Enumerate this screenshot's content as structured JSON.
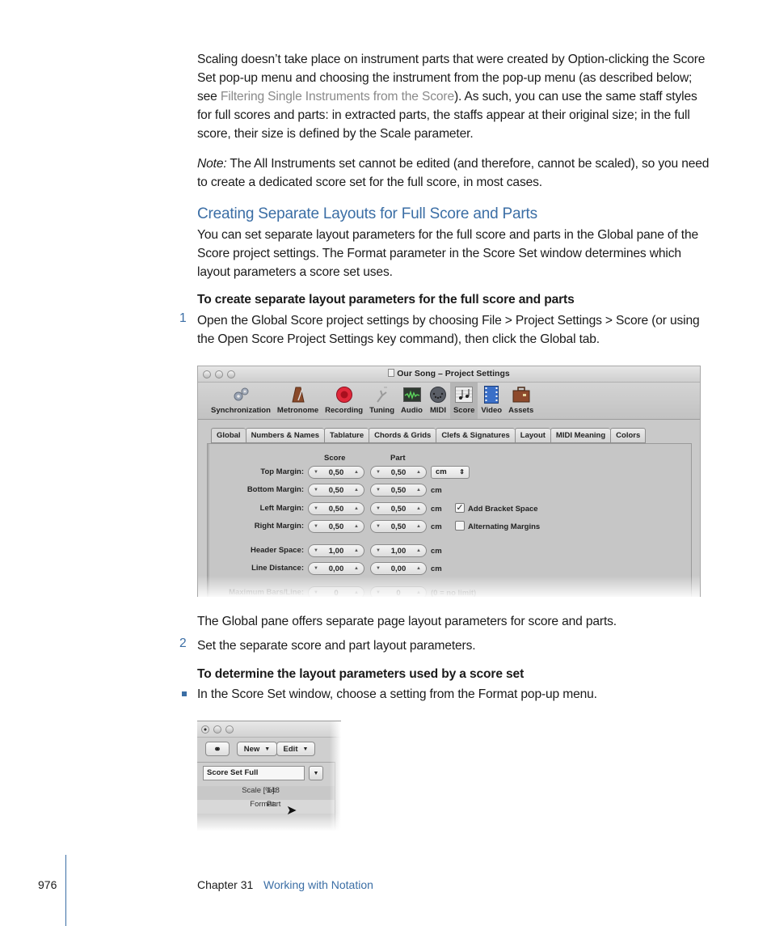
{
  "body": {
    "para1_a": "Scaling doesn’t take place on instrument parts that were created by Option-clicking the Score Set pop-up menu and choosing the instrument from the pop-up menu (as described below; see ",
    "para1_link": "Filtering Single Instruments from the Score",
    "para1_b": "). As such, you can use the same staff styles for full scores and parts:  in extracted parts, the staffs appear at their original size; in the full score, their size is defined by the Scale parameter.",
    "note_label": "Note:",
    "note_text": "  The All Instruments set cannot be edited (and therefore, cannot be scaled), so you need to create a dedicated score set for the full score, in most cases.",
    "heading": "Creating Separate Layouts for Full Score and Parts",
    "para2": "You can set separate layout parameters for the full score and parts in the Global pane of the Score project settings. The Format parameter in the Score Set window determines which layout parameters a score set uses.",
    "task1_heading": "To create separate layout parameters for the full score and parts",
    "step1_num": "1",
    "step1_text": "Open the Global Score project settings by choosing File > Project Settings > Score (or using the Open Score Project Settings key command), then click the Global tab.",
    "caption1": "The Global pane offers separate page layout parameters for score and parts.",
    "step2_num": "2",
    "step2_text": "Set the separate score and part layout parameters.",
    "task2_heading": "To determine the layout parameters used by a score set",
    "bullet1_text": "In the Score Set window, choose a setting from the Format pop-up menu."
  },
  "project_settings_window": {
    "title": "Our Song – Project Settings",
    "toolbar": [
      {
        "label": "Synchronization",
        "icon": "gears-icon"
      },
      {
        "label": "Metronome",
        "icon": "metronome-icon"
      },
      {
        "label": "Recording",
        "icon": "record-icon"
      },
      {
        "label": "Tuning",
        "icon": "tuning-fork-icon"
      },
      {
        "label": "Audio",
        "icon": "audio-waveform-icon"
      },
      {
        "label": "MIDI",
        "icon": "midi-connector-icon"
      },
      {
        "label": "Score",
        "icon": "score-notes-icon",
        "active": true
      },
      {
        "label": "Video",
        "icon": "film-icon"
      },
      {
        "label": "Assets",
        "icon": "briefcase-icon"
      }
    ],
    "tabs": [
      {
        "label": "Global",
        "active": true
      },
      {
        "label": "Numbers & Names"
      },
      {
        "label": "Tablature"
      },
      {
        "label": "Chords & Grids"
      },
      {
        "label": "Clefs & Signatures"
      },
      {
        "label": "Layout"
      },
      {
        "label": "MIDI Meaning"
      },
      {
        "label": "Colors"
      }
    ],
    "col_score": "Score",
    "col_part": "Part",
    "unit_select": "cm",
    "rows": [
      {
        "label": "Top Margin:",
        "score": "0,50",
        "part": "0,50"
      },
      {
        "label": "Bottom Margin:",
        "score": "0,50",
        "part": "0,50",
        "unit": "cm"
      },
      {
        "label": "Left Margin:",
        "score": "0,50",
        "part": "0,50",
        "unit": "cm"
      },
      {
        "label": "Right Margin:",
        "score": "0,50",
        "part": "0,50",
        "unit": "cm"
      },
      {
        "label": "Header Space:",
        "score": "1,00",
        "part": "1,00",
        "unit": "cm"
      },
      {
        "label": "Line Distance:",
        "score": "0,00",
        "part": "0,00",
        "unit": "cm"
      },
      {
        "label": "Maximum Bars/Line:",
        "score": "0",
        "part": "0",
        "unit": "(0 = no limit)"
      }
    ],
    "checkboxes": [
      {
        "label": "Add Bracket Space",
        "checked": true
      },
      {
        "label": "Alternating Margins",
        "checked": false
      }
    ]
  },
  "score_set_window": {
    "new_label": "New",
    "edit_label": "Edit",
    "set_name": "Score Set Full",
    "scale_label": "Scale [%]:",
    "scale_value": "148",
    "format_label": "Format:",
    "format_value": "Part"
  },
  "footer": {
    "page_number": "976",
    "chapter": "Chapter 31",
    "chapter_title": "Working with Notation"
  }
}
